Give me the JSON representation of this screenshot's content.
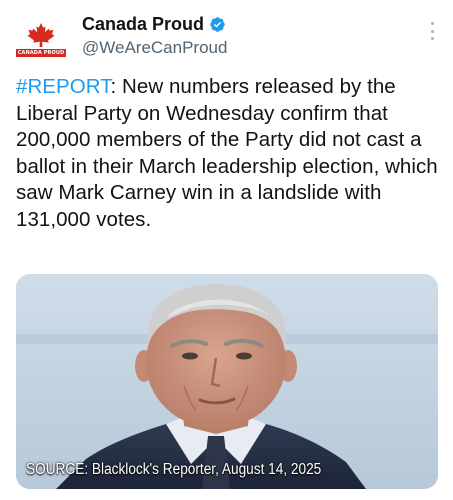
{
  "account": {
    "display_name": "Canada Proud",
    "handle": "@WeAreCanProud",
    "avatar_text": "CANADA PROUD",
    "verified": true
  },
  "tweet": {
    "hashtag": "#REPORT",
    "body": ": New numbers released by the Liberal Party on Wednesday confirm that 200,000 members of the Party did not cast a ballot in their March leadership election, which saw Mark Carney win in a landslide with 131,000 votes."
  },
  "media": {
    "caption": "SOURCE: Blacklock's Reporter, August 14, 2025"
  },
  "colors": {
    "hashtag": "#1d9bf0",
    "verified_badge": "#1d9bf0",
    "brand_red": "#d52b1e"
  },
  "icons": {
    "verified": "verified-badge-icon",
    "more": "more-vertical-icon",
    "logo": "maple-leaf-icon"
  }
}
